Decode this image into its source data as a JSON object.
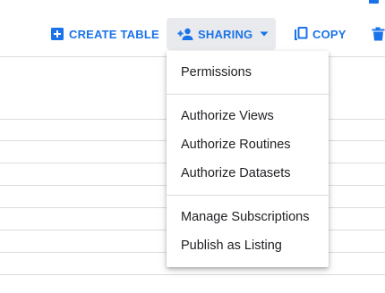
{
  "toolbar": {
    "create_table_label": "CREATE TABLE",
    "sharing_label": "SHARING",
    "copy_label": "COPY"
  },
  "sharing_menu": {
    "groups": [
      [
        "Permissions"
      ],
      [
        "Authorize Views",
        "Authorize Routines",
        "Authorize Datasets"
      ],
      [
        "Manage Subscriptions",
        "Publish as Listing"
      ]
    ],
    "items": [
      "Permissions",
      "Authorize Views",
      "Authorize Routines",
      "Authorize Datasets",
      "Manage Subscriptions",
      "Publish as Listing"
    ]
  },
  "colors": {
    "accent": "#1a73e8",
    "button_active_bg": "#e8eaed",
    "divider": "#dadce0",
    "text": "#202124"
  },
  "icons": {
    "create_table": "add-box-icon",
    "sharing": "person-add-icon",
    "sharing_caret": "caret-down-icon",
    "copy": "content-copy-icon",
    "delete": "trash-icon"
  }
}
